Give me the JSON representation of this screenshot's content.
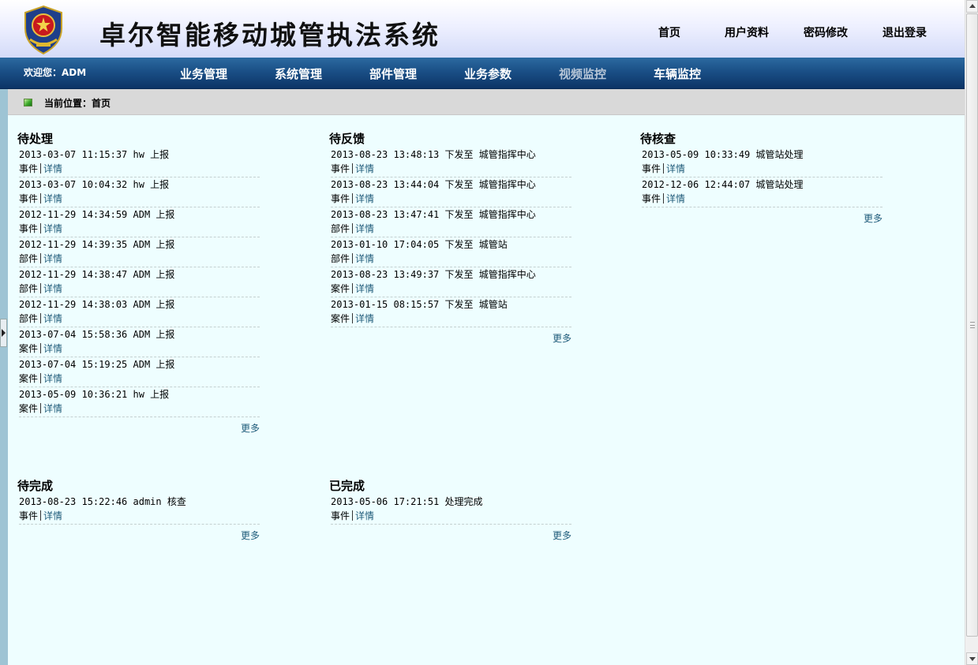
{
  "header": {
    "title": "卓尔智能移动城管执法系统",
    "top_links": [
      "首页",
      "用户资料",
      "密码修改",
      "退出登录"
    ]
  },
  "nav": {
    "welcome": "欢迎您：ADM",
    "items": [
      "业务管理",
      "系统管理",
      "部件管理",
      "业务参数",
      "视频监控",
      "车辆监控"
    ],
    "dimmed_item": "视频监控"
  },
  "breadcrumb": {
    "text": "当前位置：首页"
  },
  "labels": {
    "detail": "详情",
    "more": "更多"
  },
  "panels": {
    "pending": {
      "title": "待处理",
      "entries": [
        {
          "time": "2013-03-07 11:15:37 hw 上报",
          "type": "事件"
        },
        {
          "time": "2013-03-07 10:04:32 hw 上报",
          "type": "事件"
        },
        {
          "time": "2012-11-29 14:34:59 ADM 上报",
          "type": "事件"
        },
        {
          "time": "2012-11-29 14:39:35 ADM 上报",
          "type": "部件"
        },
        {
          "time": "2012-11-29 14:38:47 ADM 上报",
          "type": "部件"
        },
        {
          "time": "2012-11-29 14:38:03 ADM 上报",
          "type": "部件"
        },
        {
          "time": "2013-07-04 15:58:36 ADM 上报",
          "type": "案件"
        },
        {
          "time": "2013-07-04 15:19:25 ADM 上报",
          "type": "案件"
        },
        {
          "time": "2013-05-09 10:36:21 hw 上报",
          "type": "案件"
        }
      ]
    },
    "feedback": {
      "title": "待反馈",
      "entries": [
        {
          "time": "2013-08-23 13:48:13 下发至 城管指挥中心",
          "type": "事件"
        },
        {
          "time": "2013-08-23 13:44:04 下发至 城管指挥中心",
          "type": "事件"
        },
        {
          "time": "2013-08-23 13:47:41 下发至 城管指挥中心",
          "type": "部件"
        },
        {
          "time": "2013-01-10 17:04:05 下发至 城管站",
          "type": "部件"
        },
        {
          "time": "2013-08-23 13:49:37 下发至 城管指挥中心",
          "type": "案件"
        },
        {
          "time": "2013-01-15 08:15:57 下发至 城管站",
          "type": "案件"
        }
      ]
    },
    "verify": {
      "title": "待核查",
      "entries": [
        {
          "time": "2013-05-09 10:33:49 城管站处理",
          "type": "事件"
        },
        {
          "time": "2012-12-06 12:44:07 城管站处理",
          "type": "事件"
        }
      ]
    },
    "tocomplete": {
      "title": "待完成",
      "entries": [
        {
          "time": "2013-08-23 15:22:46 admin 核查",
          "type": "事件"
        }
      ]
    },
    "completed": {
      "title": "已完成",
      "entries": [
        {
          "time": "2013-05-06 17:21:51 处理完成",
          "type": "事件"
        }
      ]
    }
  }
}
